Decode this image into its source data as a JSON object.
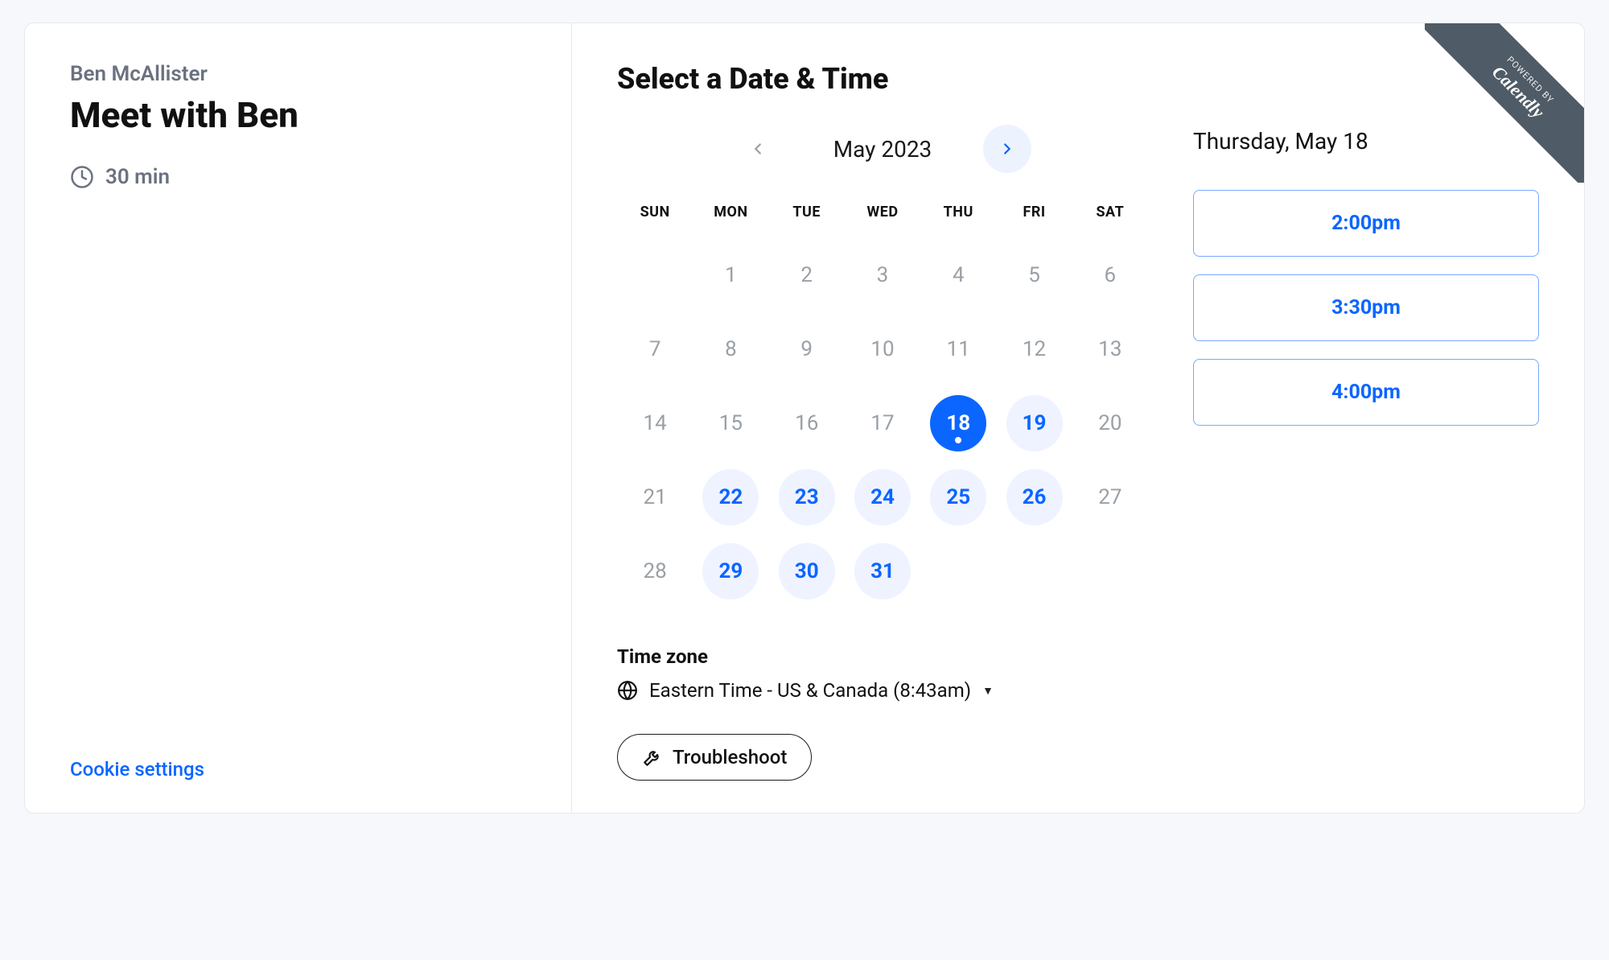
{
  "host_name": "Ben McAllister",
  "event_title": "Meet with Ben",
  "duration_label": "30 min",
  "cookie_settings_label": "Cookie settings",
  "right": {
    "heading": "Select a Date & Time",
    "month_label": "May 2023",
    "dow": [
      "SUN",
      "MON",
      "TUE",
      "WED",
      "THU",
      "FRI",
      "SAT"
    ],
    "weeks": [
      [
        {
          "n": "",
          "state": "blank"
        },
        {
          "n": "1",
          "state": "past"
        },
        {
          "n": "2",
          "state": "past"
        },
        {
          "n": "3",
          "state": "past"
        },
        {
          "n": "4",
          "state": "past"
        },
        {
          "n": "5",
          "state": "past"
        },
        {
          "n": "6",
          "state": "past"
        }
      ],
      [
        {
          "n": "7",
          "state": "past"
        },
        {
          "n": "8",
          "state": "past"
        },
        {
          "n": "9",
          "state": "past"
        },
        {
          "n": "10",
          "state": "past"
        },
        {
          "n": "11",
          "state": "past"
        },
        {
          "n": "12",
          "state": "past"
        },
        {
          "n": "13",
          "state": "past"
        }
      ],
      [
        {
          "n": "14",
          "state": "past"
        },
        {
          "n": "15",
          "state": "past"
        },
        {
          "n": "16",
          "state": "past"
        },
        {
          "n": "17",
          "state": "past"
        },
        {
          "n": "18",
          "state": "selected"
        },
        {
          "n": "19",
          "state": "available"
        },
        {
          "n": "20",
          "state": "past"
        }
      ],
      [
        {
          "n": "21",
          "state": "past"
        },
        {
          "n": "22",
          "state": "available"
        },
        {
          "n": "23",
          "state": "available"
        },
        {
          "n": "24",
          "state": "available"
        },
        {
          "n": "25",
          "state": "available"
        },
        {
          "n": "26",
          "state": "available"
        },
        {
          "n": "27",
          "state": "past"
        }
      ],
      [
        {
          "n": "28",
          "state": "past"
        },
        {
          "n": "29",
          "state": "available"
        },
        {
          "n": "30",
          "state": "available"
        },
        {
          "n": "31",
          "state": "available"
        },
        {
          "n": "",
          "state": "blank"
        },
        {
          "n": "",
          "state": "blank"
        },
        {
          "n": "",
          "state": "blank"
        }
      ]
    ],
    "timezone_heading": "Time zone",
    "timezone_value": "Eastern Time - US & Canada (8:43am)",
    "selected_date_label": "Thursday, May 18",
    "time_slots": [
      "2:00pm",
      "3:30pm",
      "4:00pm"
    ],
    "troubleshoot_label": "Troubleshoot"
  },
  "ribbon": {
    "small": "POWERED BY",
    "brand": "Calendly"
  }
}
